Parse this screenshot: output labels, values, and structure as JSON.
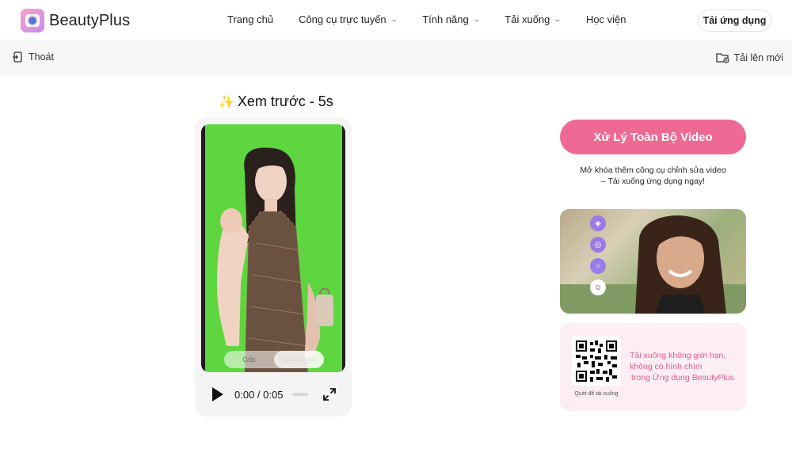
{
  "brand": {
    "name": "BeautyPlus"
  },
  "nav": {
    "items": [
      {
        "label": "Trang chủ",
        "dropdown": false
      },
      {
        "label": "Công cụ trực tuyến",
        "dropdown": true
      },
      {
        "label": "Tính năng",
        "dropdown": true
      },
      {
        "label": "Tải xuống",
        "dropdown": true
      },
      {
        "label": "Học viện",
        "dropdown": false
      }
    ],
    "app_button": "Tải ứng dụng"
  },
  "subbar": {
    "exit_label": "Thoát",
    "upload_label": "Tải lên mới"
  },
  "preview": {
    "title": "Xem trước - 5s",
    "toggle": {
      "original": "Gốc",
      "preview": "Xem trước",
      "active": "preview"
    },
    "player": {
      "time": "0:00 / 0:05"
    }
  },
  "sidebar": {
    "process_button": "Xử Lý Toàn Bộ Video",
    "promo_line1": "Mở khóa thêm công cụ chỉnh sửa video",
    "promo_line2": "– Tải xuống ứng dụng ngay!",
    "qr_caption": "Quét để tải xuống",
    "qr_text": [
      "Tải xuống không giới hạn,",
      "không có hình chìm",
      "trong Ứng dụng BeautyPlus"
    ]
  },
  "colors": {
    "accent": "#ee6a94",
    "chroma_green": "#5ed63f",
    "tool_purple": "#9b7ce6",
    "qr_card_bg": "#fdeef3"
  }
}
